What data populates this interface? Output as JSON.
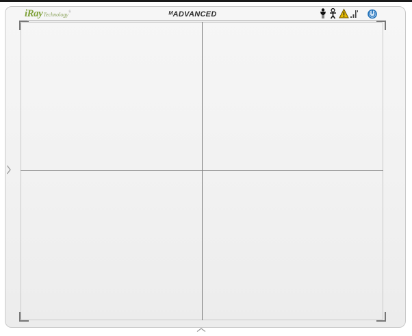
{
  "header": {
    "logo_main": "iRay",
    "logo_sub": "Technology",
    "logo_mark": "®",
    "brand": "ᴹADVANCED"
  },
  "status_icons": [
    {
      "name": "person-icon",
      "color": "#111111"
    },
    {
      "name": "patient-icon",
      "color": "#111111"
    },
    {
      "name": "warning-icon",
      "color": "#e0b000"
    },
    {
      "name": "signal-icon",
      "color": "#444444"
    },
    {
      "name": "power-icon",
      "color": "#1e6fb8"
    }
  ],
  "colors": {
    "logo": "#7fa23a",
    "grid_line": "#7c7c7c",
    "panel_bg": "#f3f3f3"
  }
}
